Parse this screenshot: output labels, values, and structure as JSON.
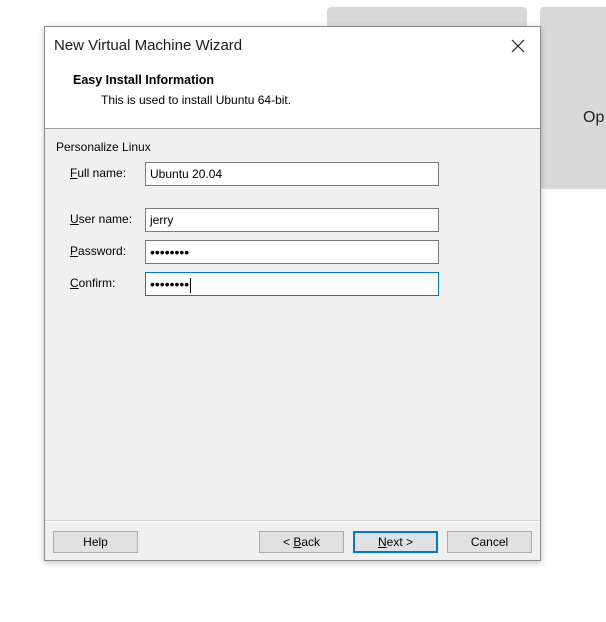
{
  "background": {
    "partial_text": "Op"
  },
  "dialog": {
    "title": "New Virtual Machine Wizard",
    "close_icon": "close-icon",
    "header": {
      "title": "Easy Install Information",
      "subtitle": "This is used to install Ubuntu 64-bit."
    },
    "group_label": "Personalize Linux",
    "fields": {
      "full_name": {
        "label_mnemonic": "F",
        "label_rest": "ull name:",
        "value": "Ubuntu 20.04"
      },
      "user_name": {
        "label_mnemonic": "U",
        "label_rest": "ser name:",
        "value": "jerry"
      },
      "password": {
        "label_mnemonic": "P",
        "label_rest": "assword:",
        "value": "••••••••"
      },
      "confirm": {
        "label_mnemonic": "C",
        "label_rest": "onfirm:",
        "value": "••••••••"
      }
    },
    "buttons": {
      "help": "Help",
      "back_prefix": "< ",
      "back_mnemonic": "B",
      "back_rest": "ack",
      "next_mnemonic": "N",
      "next_rest": "ext >",
      "cancel": "Cancel"
    },
    "colors": {
      "accent": "#0078d7",
      "dialog_bg": "#f0f0f0",
      "button_bg": "#e1e1e1"
    }
  }
}
